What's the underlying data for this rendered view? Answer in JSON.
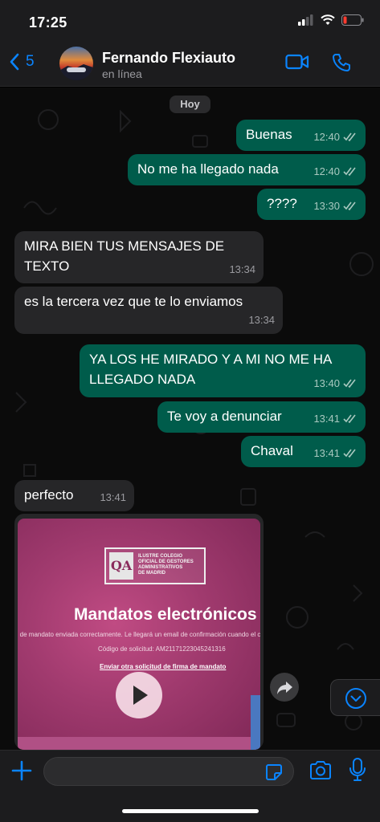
{
  "status_bar": {
    "time": "17:25"
  },
  "header": {
    "back_count": "5",
    "contact_name": "Fernando Flexiauto",
    "contact_status": "en línea"
  },
  "chat": {
    "date_label": "Hoy",
    "messages": [
      {
        "dir": "out",
        "text": "Buenas",
        "time": "12:40"
      },
      {
        "dir": "out",
        "text": "No me ha llegado nada",
        "time": "12:40"
      },
      {
        "dir": "out",
        "text": "????",
        "time": "13:30"
      },
      {
        "dir": "in",
        "text": "MIRA BIEN TUS MENSAJES DE\nTEXTO",
        "time": "13:34"
      },
      {
        "dir": "in",
        "text": "es la tercera vez que te lo enviamos",
        "time": "13:34"
      },
      {
        "dir": "out",
        "text": "YA LOS HE MIRADO Y A MI NO ME HA\nLLEGADO NADA",
        "time": "13:40"
      },
      {
        "dir": "out",
        "text": "Te voy a denunciar",
        "time": "13:41"
      },
      {
        "dir": "out",
        "text": "Chaval",
        "time": "13:41"
      },
      {
        "dir": "in",
        "text": "perfecto",
        "time": "13:41"
      }
    ],
    "media": {
      "logo_mark": "QA",
      "logo_text": "ILUSTRE COLEGIO\nOFICIAL DE GESTORES\nADMINISTRATIVOS\nDE MADRID",
      "title": "Mandatos electrónicos",
      "line1": "d de mandato enviada correctamente. Le llegará un email de confirmación cuando el cliente f",
      "line2": "Código de solicitud: AM21171223045241316",
      "line3": "Enviar otra solicitud de firma de mandato"
    }
  },
  "colors": {
    "outgoing_bubble": "#005c4b",
    "incoming_bubble": "#262628",
    "accent": "#0a84ff"
  },
  "icons": [
    "back-chevron-icon",
    "video-call-icon",
    "voice-call-icon",
    "double-check-icon",
    "play-icon",
    "forward-icon",
    "chevron-down-icon",
    "plus-icon",
    "sticker-icon",
    "camera-icon",
    "microphone-icon"
  ]
}
